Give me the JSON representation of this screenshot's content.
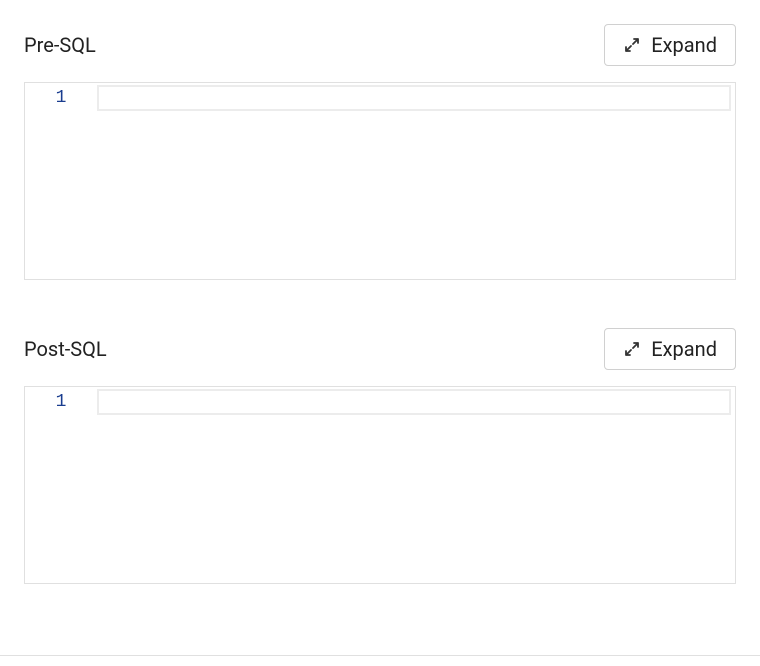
{
  "sections": [
    {
      "label": "Pre-SQL",
      "expand_label": "Expand",
      "line_number": "1",
      "value": ""
    },
    {
      "label": "Post-SQL",
      "expand_label": "Expand",
      "line_number": "1",
      "value": ""
    }
  ]
}
